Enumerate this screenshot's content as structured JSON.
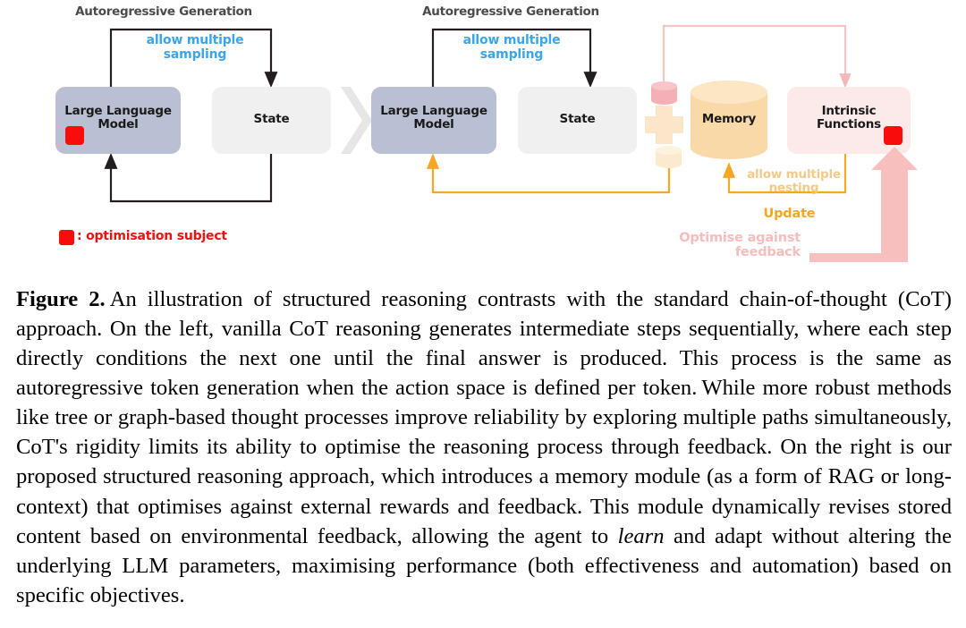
{
  "figure": {
    "headers": [
      {
        "label": "Autoregressive Generation"
      },
      {
        "label": "Autoregressive Generation"
      }
    ],
    "sampling_labels": [
      {
        "label": "allow multiple\nsampling"
      },
      {
        "label": "allow multiple\nsampling"
      }
    ],
    "nodes": {
      "llm_left": {
        "label": "Large Language\nModel"
      },
      "state_left": {
        "label": "State"
      },
      "llm_right": {
        "label": "Large Language\nModel"
      },
      "state_right": {
        "label": "State"
      },
      "memory": {
        "label": "Memory"
      },
      "intrinsic_functions": {
        "label": "Intrinsic\nFunctions"
      }
    },
    "edge_labels": {
      "nesting": "allow multiple\nnesting",
      "update": "Update",
      "optimise": "Optimise against\nfeedback"
    },
    "legend": {
      "text": ": optimisation subject"
    },
    "colors": {
      "llm_box": "#b9c0d4",
      "state_box": "#f0f0f0",
      "chevron": "#e6e6e6",
      "memory_body": "#fad9a8",
      "memory_top": "#fce6c4",
      "intrinsic_box": "#fceaea",
      "plus": "#fbe6ca",
      "pink_cylinder": "#f6bcc0",
      "cream_cylinder": "#fbeacd",
      "red_square": "#f80c0c",
      "black_arrow": "#231f20",
      "orange_arrow": "#f5a623",
      "pink_arrow": "#f9c6c6",
      "thick_pink_arrow": "#f8bfbf",
      "sampling_blue": "#3aa6e8",
      "header_grey": "#4b4b4b",
      "nesting_orange": "#f3c98b",
      "optimise_pink": "#f7bcbc",
      "legend_red": "#ee1111"
    }
  },
  "caption": {
    "figure_number": "Figure 2.",
    "part1": "An illustration of structured reasoning contrasts with the standard chain-of-thought (CoT) approach. On the left, vanilla CoT reasoning generates intermediate steps sequentially, where each step directly conditions the next one until the final answer is produced. This process is the same as autoregressive token generation when the action space is defined per token.",
    "part2": "While more robust methods like tree or graph-based thought processes improve reliability by exploring multiple paths simultaneously, CoT's rigidity limits its ability to optimise the reasoning process through feedback. On the right is our proposed structured reasoning approach, which introduces a memory module (as a form of RAG or long-context) that optimises against external rewards and feedback. This module dynamically revises stored content based on environmental feedback, allowing the agent to",
    "italic_word": "learn",
    "part3": "and adapt without altering the underlying LLM parameters, maximising performance (both effectiveness and automation) based on specific objectives."
  }
}
